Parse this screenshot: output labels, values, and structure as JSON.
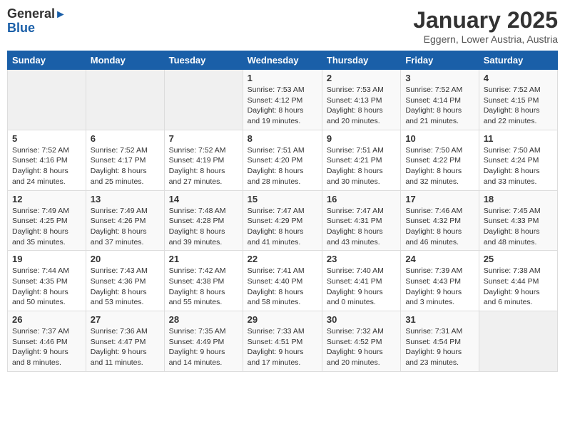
{
  "logo": {
    "general": "General",
    "blue": "Blue",
    "arrow": "▶"
  },
  "title": "January 2025",
  "location": "Eggern, Lower Austria, Austria",
  "days_header": [
    "Sunday",
    "Monday",
    "Tuesday",
    "Wednesday",
    "Thursday",
    "Friday",
    "Saturday"
  ],
  "weeks": [
    [
      {
        "day": "",
        "content": ""
      },
      {
        "day": "",
        "content": ""
      },
      {
        "day": "",
        "content": ""
      },
      {
        "day": "1",
        "content": "Sunrise: 7:53 AM\nSunset: 4:12 PM\nDaylight: 8 hours\nand 19 minutes."
      },
      {
        "day": "2",
        "content": "Sunrise: 7:53 AM\nSunset: 4:13 PM\nDaylight: 8 hours\nand 20 minutes."
      },
      {
        "day": "3",
        "content": "Sunrise: 7:52 AM\nSunset: 4:14 PM\nDaylight: 8 hours\nand 21 minutes."
      },
      {
        "day": "4",
        "content": "Sunrise: 7:52 AM\nSunset: 4:15 PM\nDaylight: 8 hours\nand 22 minutes."
      }
    ],
    [
      {
        "day": "5",
        "content": "Sunrise: 7:52 AM\nSunset: 4:16 PM\nDaylight: 8 hours\nand 24 minutes."
      },
      {
        "day": "6",
        "content": "Sunrise: 7:52 AM\nSunset: 4:17 PM\nDaylight: 8 hours\nand 25 minutes."
      },
      {
        "day": "7",
        "content": "Sunrise: 7:52 AM\nSunset: 4:19 PM\nDaylight: 8 hours\nand 27 minutes."
      },
      {
        "day": "8",
        "content": "Sunrise: 7:51 AM\nSunset: 4:20 PM\nDaylight: 8 hours\nand 28 minutes."
      },
      {
        "day": "9",
        "content": "Sunrise: 7:51 AM\nSunset: 4:21 PM\nDaylight: 8 hours\nand 30 minutes."
      },
      {
        "day": "10",
        "content": "Sunrise: 7:50 AM\nSunset: 4:22 PM\nDaylight: 8 hours\nand 32 minutes."
      },
      {
        "day": "11",
        "content": "Sunrise: 7:50 AM\nSunset: 4:24 PM\nDaylight: 8 hours\nand 33 minutes."
      }
    ],
    [
      {
        "day": "12",
        "content": "Sunrise: 7:49 AM\nSunset: 4:25 PM\nDaylight: 8 hours\nand 35 minutes."
      },
      {
        "day": "13",
        "content": "Sunrise: 7:49 AM\nSunset: 4:26 PM\nDaylight: 8 hours\nand 37 minutes."
      },
      {
        "day": "14",
        "content": "Sunrise: 7:48 AM\nSunset: 4:28 PM\nDaylight: 8 hours\nand 39 minutes."
      },
      {
        "day": "15",
        "content": "Sunrise: 7:47 AM\nSunset: 4:29 PM\nDaylight: 8 hours\nand 41 minutes."
      },
      {
        "day": "16",
        "content": "Sunrise: 7:47 AM\nSunset: 4:31 PM\nDaylight: 8 hours\nand 43 minutes."
      },
      {
        "day": "17",
        "content": "Sunrise: 7:46 AM\nSunset: 4:32 PM\nDaylight: 8 hours\nand 46 minutes."
      },
      {
        "day": "18",
        "content": "Sunrise: 7:45 AM\nSunset: 4:33 PM\nDaylight: 8 hours\nand 48 minutes."
      }
    ],
    [
      {
        "day": "19",
        "content": "Sunrise: 7:44 AM\nSunset: 4:35 PM\nDaylight: 8 hours\nand 50 minutes."
      },
      {
        "day": "20",
        "content": "Sunrise: 7:43 AM\nSunset: 4:36 PM\nDaylight: 8 hours\nand 53 minutes."
      },
      {
        "day": "21",
        "content": "Sunrise: 7:42 AM\nSunset: 4:38 PM\nDaylight: 8 hours\nand 55 minutes."
      },
      {
        "day": "22",
        "content": "Sunrise: 7:41 AM\nSunset: 4:40 PM\nDaylight: 8 hours\nand 58 minutes."
      },
      {
        "day": "23",
        "content": "Sunrise: 7:40 AM\nSunset: 4:41 PM\nDaylight: 9 hours\nand 0 minutes."
      },
      {
        "day": "24",
        "content": "Sunrise: 7:39 AM\nSunset: 4:43 PM\nDaylight: 9 hours\nand 3 minutes."
      },
      {
        "day": "25",
        "content": "Sunrise: 7:38 AM\nSunset: 4:44 PM\nDaylight: 9 hours\nand 6 minutes."
      }
    ],
    [
      {
        "day": "26",
        "content": "Sunrise: 7:37 AM\nSunset: 4:46 PM\nDaylight: 9 hours\nand 8 minutes."
      },
      {
        "day": "27",
        "content": "Sunrise: 7:36 AM\nSunset: 4:47 PM\nDaylight: 9 hours\nand 11 minutes."
      },
      {
        "day": "28",
        "content": "Sunrise: 7:35 AM\nSunset: 4:49 PM\nDaylight: 9 hours\nand 14 minutes."
      },
      {
        "day": "29",
        "content": "Sunrise: 7:33 AM\nSunset: 4:51 PM\nDaylight: 9 hours\nand 17 minutes."
      },
      {
        "day": "30",
        "content": "Sunrise: 7:32 AM\nSunset: 4:52 PM\nDaylight: 9 hours\nand 20 minutes."
      },
      {
        "day": "31",
        "content": "Sunrise: 7:31 AM\nSunset: 4:54 PM\nDaylight: 9 hours\nand 23 minutes."
      },
      {
        "day": "",
        "content": ""
      }
    ]
  ]
}
